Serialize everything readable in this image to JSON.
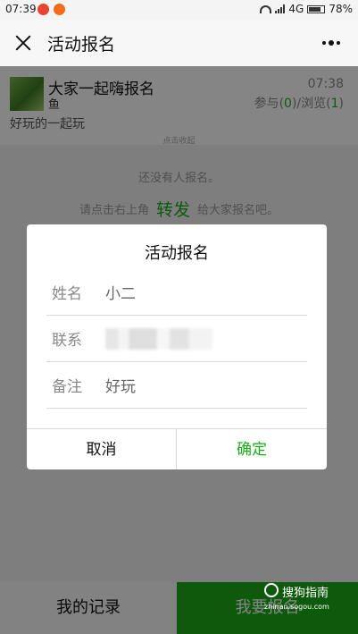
{
  "status_bar": {
    "time": "07:39",
    "network": "4G",
    "battery": "78%",
    "battery_level": 0.78
  },
  "nav": {
    "title": "活动报名"
  },
  "activity": {
    "title": "大家一起嗨报名",
    "author": "鱼",
    "time": "07:38",
    "stats_join_label": "参与",
    "join_count": "0",
    "stats_view_label": "浏览",
    "view_count": "1",
    "description": "好玩的一起玩",
    "collapse_tip": "点击收起"
  },
  "empty_state": {
    "message": "还没有人报名。",
    "hint_before": "请点击右上角",
    "hint_keyword": "转发",
    "hint_after": "给大家报名吧。"
  },
  "bottom_bar": {
    "my_records": "我的记录",
    "signup": "我要报名"
  },
  "dialog": {
    "title": "活动报名",
    "fields": [
      {
        "label": "姓名",
        "value": "小二"
      },
      {
        "label": "联系",
        "value": ""
      },
      {
        "label": "备注",
        "value": "好玩"
      }
    ],
    "cancel": "取消",
    "confirm": "确定"
  },
  "watermark": {
    "name": "搜狗指南",
    "url": "zhinan.sogou.com"
  },
  "colors": {
    "accent": "#1aad19",
    "mask": "rgba(0,0,0,0.48)"
  }
}
